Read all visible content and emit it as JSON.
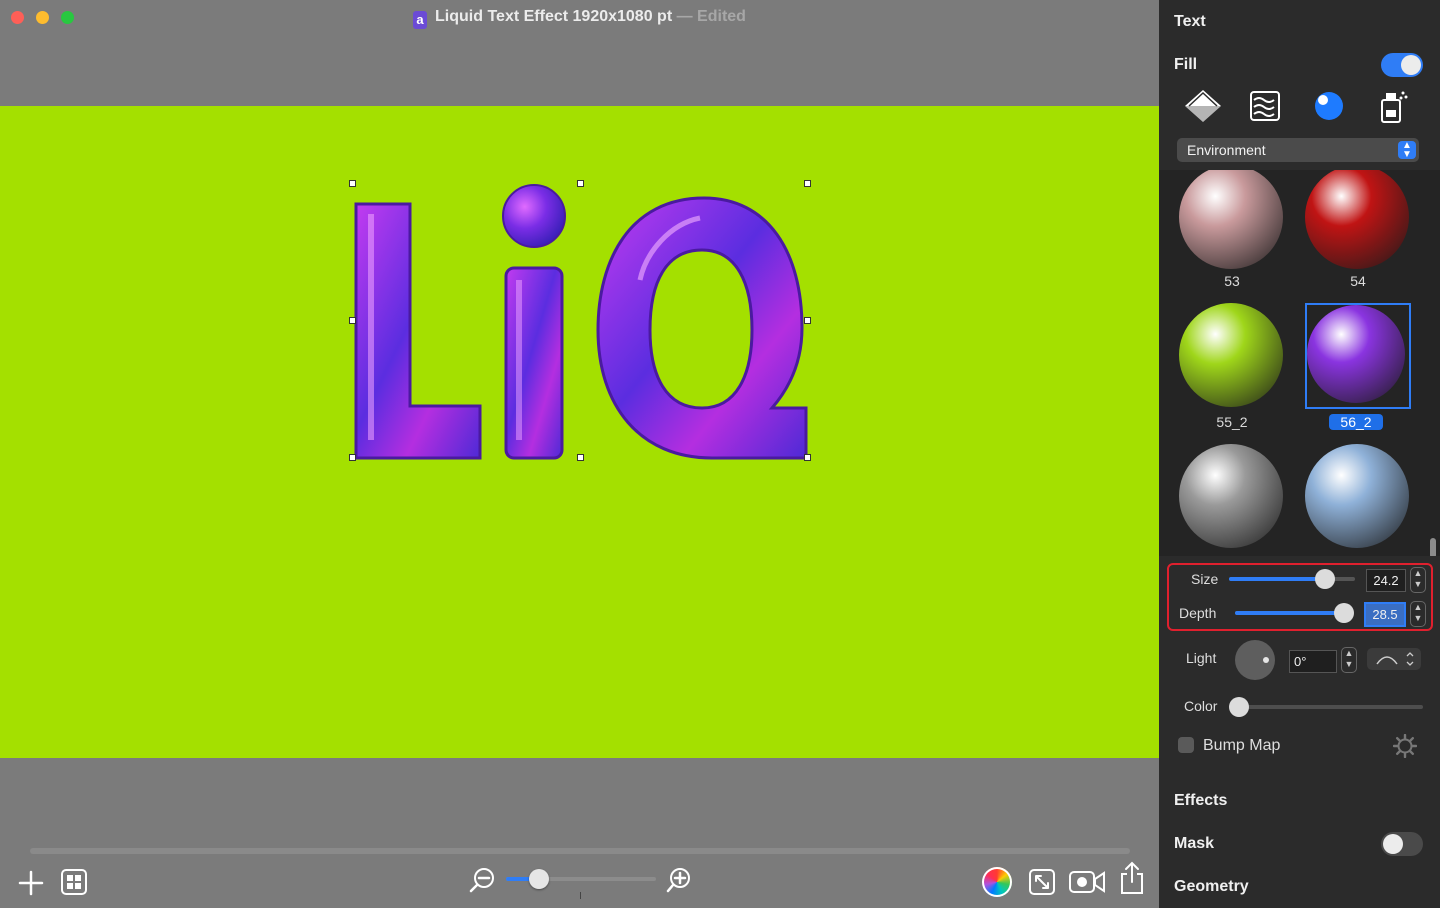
{
  "window": {
    "title": "Liquid Text Effect 1920x1080 pt",
    "edited": "— Edited"
  },
  "canvas": {
    "background_color": "#a4e000",
    "text": "LiQ"
  },
  "panel": {
    "text_section": "Text",
    "fill_section": "Fill",
    "fill_enabled": true,
    "fill_icons": [
      "paint-bucket-icon",
      "texture-icon",
      "environment-sphere-icon",
      "spray-icon"
    ],
    "environment_select": "Environment",
    "swatches": [
      {
        "label": "53",
        "color": "#c99a9c"
      },
      {
        "label": "54",
        "color": "#c01414"
      },
      {
        "label": "55_2",
        "color": "#9fd61a"
      },
      {
        "label": "56_2",
        "color": "#8a34e0",
        "selected": true
      },
      {
        "label": "",
        "color": "#9a9a9a"
      },
      {
        "label": "",
        "color": "#8fb1d8"
      }
    ],
    "size": {
      "label": "Size",
      "value": "24.2",
      "level": 0.76
    },
    "depth": {
      "label": "Depth",
      "value": "28.5",
      "level": 0.92
    },
    "light": {
      "label": "Light",
      "value": "0°"
    },
    "color": {
      "label": "Color",
      "level": 0.0
    },
    "bump_map": {
      "label": "Bump Map",
      "checked": false
    },
    "effects_section": "Effects",
    "mask_section": "Mask",
    "mask_enabled": false,
    "geometry_section": "Geometry"
  },
  "toolbar": {
    "zoom_level": 0.22,
    "icons": [
      "add-icon",
      "layout-icon",
      "zoom-out-icon",
      "zoom-in-icon",
      "color-wheel-icon",
      "resize-icon",
      "record-icon",
      "share-icon"
    ]
  }
}
